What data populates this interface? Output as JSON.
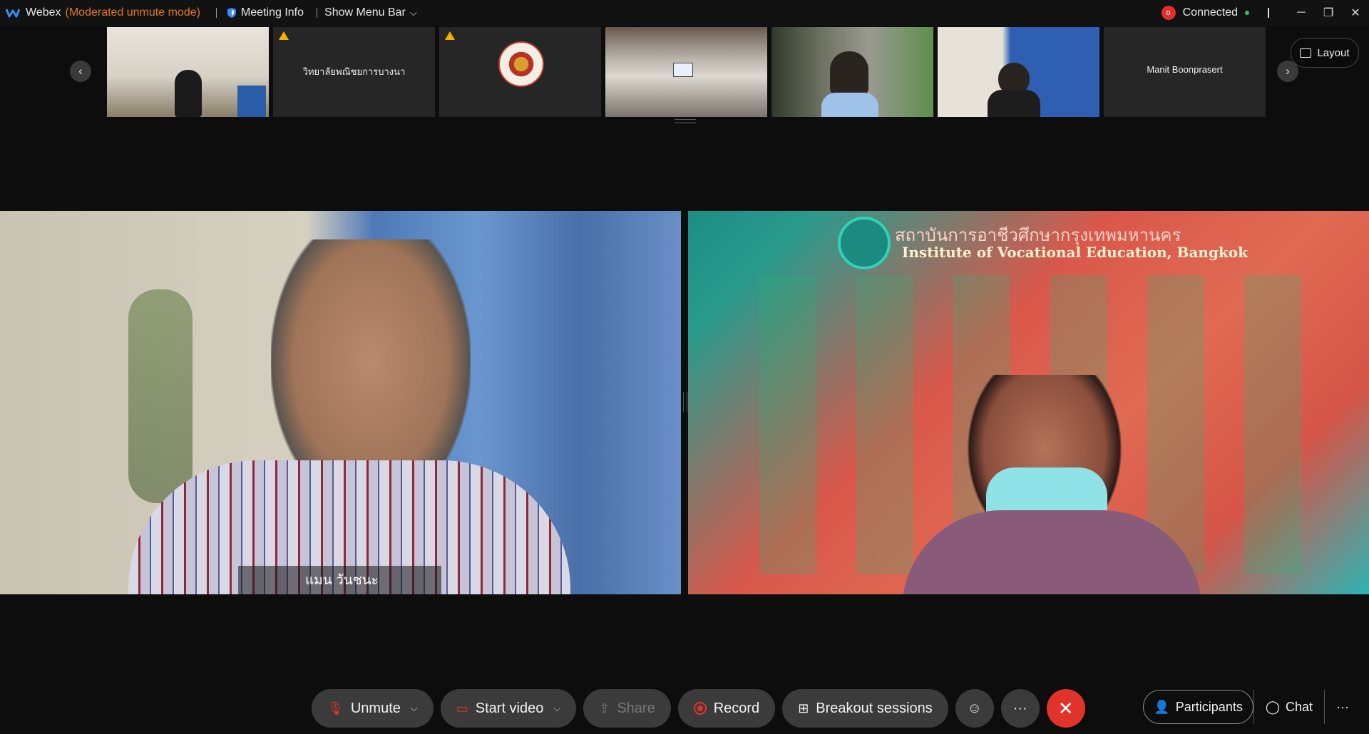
{
  "titlebar": {
    "app_name": "Webex",
    "mode": "(Moderated unmute mode)",
    "meeting_info": "Meeting Info",
    "show_menu_bar": "Show Menu Bar",
    "connection_status": "Connected",
    "recording_badge": "o"
  },
  "thumbnails": [
    {
      "name": "",
      "warning": false
    },
    {
      "name": "วิทยาลัยพณิชยการบางนา",
      "warning": true
    },
    {
      "name": "",
      "warning": true,
      "logo": "seal-logo"
    },
    {
      "name": "",
      "warning": false
    },
    {
      "name": "",
      "warning": false
    },
    {
      "name": "",
      "warning": false
    },
    {
      "name": "Manit Boonprasert",
      "warning": false
    }
  ],
  "layout_label": "Layout",
  "main": {
    "left_speaker": "แมน วันชนะ",
    "right_banner_th": "สถาบันการอาชีวศึกษากรุงเทพมหานคร",
    "right_banner_en": "Institute of Vocational Education, Bangkok"
  },
  "controls": {
    "unmute": "Unmute",
    "start_video": "Start video",
    "share": "Share",
    "record": "Record",
    "breakout": "Breakout sessions",
    "reactions_icon": "smiley-icon",
    "more_icon": "ellipsis-icon",
    "end_icon": "close-icon"
  },
  "right_panel": {
    "participants": "Participants",
    "chat": "Chat"
  },
  "colors": {
    "accent_mode": "#e0791c",
    "end_call": "#e2332b",
    "background": "#0d0d0d"
  }
}
